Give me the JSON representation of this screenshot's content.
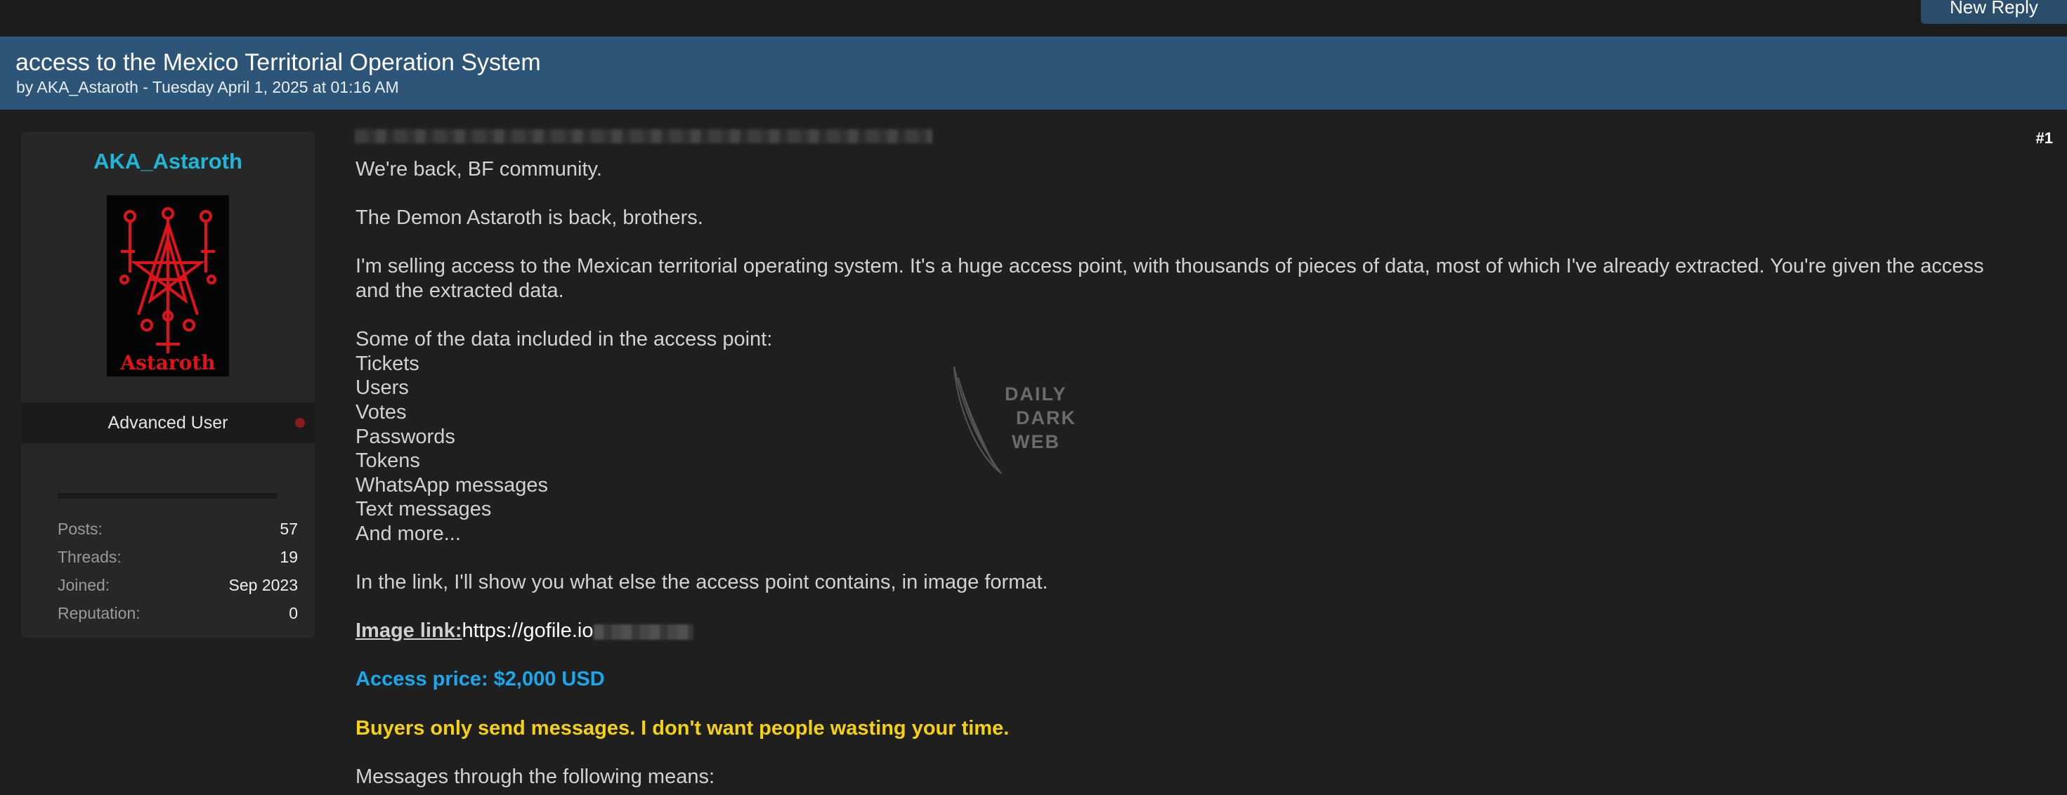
{
  "header": {
    "new_reply_label": "New Reply",
    "thread_title": "access to the Mexico Territorial Operation System",
    "thread_meta": "by AKA_Astaroth - Tuesday April 1, 2025 at 01:16 AM"
  },
  "user": {
    "username": "AKA_Astaroth",
    "avatar_text": "Astaroth",
    "role": "Advanced User",
    "stats": [
      {
        "label": "Posts:",
        "value": "57"
      },
      {
        "label": "Threads:",
        "value": "19"
      },
      {
        "label": "Joined:",
        "value": "Sep 2023"
      },
      {
        "label": "Reputation:",
        "value": "0"
      }
    ]
  },
  "post": {
    "number": "#1",
    "lines": {
      "l1": "We're back, BF community.",
      "l2": "The Demon Astaroth is back, brothers.",
      "l3": "I'm selling access to the Mexican territorial operating system. It's a huge access point, with thousands of pieces of data, most of which I've already extracted. You're given the access",
      "l4": "and the extracted data.",
      "l5": "Some of the data included in the access point:",
      "items": [
        "Tickets",
        "Users",
        "Votes",
        "Passwords",
        "Tokens",
        "WhatsApp messages",
        "Text messages",
        "And more..."
      ],
      "l6": "In the link, I'll show you what else the access point contains, in image format.",
      "image_label": "Image link:",
      "image_url": "https://gofile.io",
      "price": "Access price: $2,000 USD",
      "warning": "Buyers only send messages. I don't want people wasting your time.",
      "l7": "Messages through the following means:"
    }
  },
  "watermark": {
    "line1": "DAILY",
    "line2": "DARK",
    "line3": "WEB"
  },
  "colors": {
    "header_bar": "#2c5578",
    "username": "#1fb6d8",
    "price": "#1aa7ec",
    "warning": "#f5d20e",
    "avatar_sigil": "#e0121b"
  }
}
